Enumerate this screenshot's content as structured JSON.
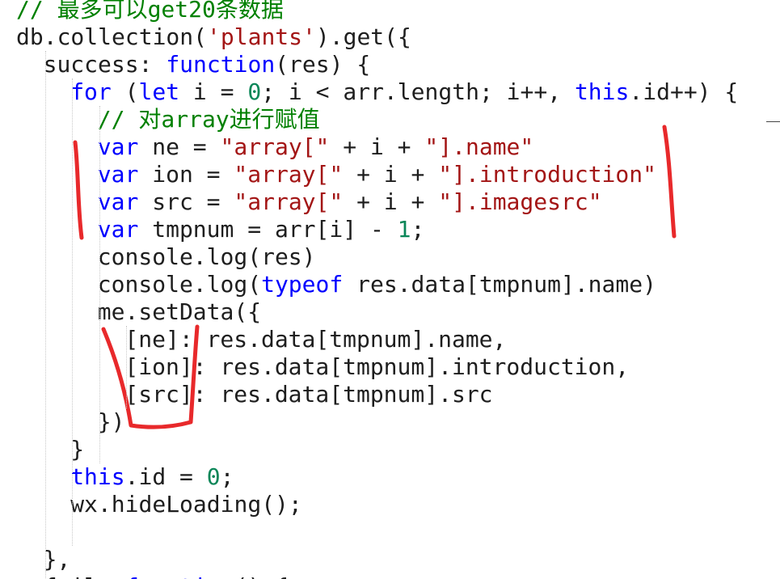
{
  "code_lines": [
    {
      "indent": 0,
      "tokens": [
        {
          "t": "// 最多可以get20条数据",
          "c": "cmt"
        }
      ]
    },
    {
      "indent": 0,
      "tokens": [
        {
          "t": "db.collection(",
          "c": ""
        },
        {
          "t": "'plants'",
          "c": "str"
        },
        {
          "t": ").get({",
          "c": ""
        }
      ]
    },
    {
      "indent": 2,
      "tokens": [
        {
          "t": "success: ",
          "c": ""
        },
        {
          "t": "function",
          "c": "kw"
        },
        {
          "t": "(res) {",
          "c": ""
        }
      ]
    },
    {
      "indent": 4,
      "tokens": [
        {
          "t": "for",
          "c": "kw"
        },
        {
          "t": " (",
          "c": ""
        },
        {
          "t": "let",
          "c": "kw"
        },
        {
          "t": " i = ",
          "c": ""
        },
        {
          "t": "0",
          "c": "num"
        },
        {
          "t": "; i < arr.length; i++, ",
          "c": ""
        },
        {
          "t": "this",
          "c": "kw"
        },
        {
          "t": ".id++) {",
          "c": ""
        }
      ]
    },
    {
      "indent": 6,
      "tokens": [
        {
          "t": "// 对array进行赋值",
          "c": "cmt"
        }
      ]
    },
    {
      "indent": 6,
      "tokens": [
        {
          "t": "var",
          "c": "kw"
        },
        {
          "t": " ne = ",
          "c": ""
        },
        {
          "t": "\"array[\"",
          "c": "str"
        },
        {
          "t": " + i + ",
          "c": ""
        },
        {
          "t": "\"].name\"",
          "c": "str"
        }
      ]
    },
    {
      "indent": 6,
      "tokens": [
        {
          "t": "var",
          "c": "kw"
        },
        {
          "t": " ion = ",
          "c": ""
        },
        {
          "t": "\"array[\"",
          "c": "str"
        },
        {
          "t": " + i + ",
          "c": ""
        },
        {
          "t": "\"].introduction\"",
          "c": "str"
        }
      ]
    },
    {
      "indent": 6,
      "tokens": [
        {
          "t": "var",
          "c": "kw"
        },
        {
          "t": " src = ",
          "c": ""
        },
        {
          "t": "\"array[\"",
          "c": "str"
        },
        {
          "t": " + i + ",
          "c": ""
        },
        {
          "t": "\"].imagesrc\"",
          "c": "str"
        }
      ]
    },
    {
      "indent": 6,
      "tokens": [
        {
          "t": "var",
          "c": "kw"
        },
        {
          "t": " tmpnum = arr[i] - ",
          "c": ""
        },
        {
          "t": "1",
          "c": "num"
        },
        {
          "t": ";",
          "c": ""
        }
      ]
    },
    {
      "indent": 6,
      "tokens": [
        {
          "t": "console.log(res)",
          "c": ""
        }
      ]
    },
    {
      "indent": 6,
      "tokens": [
        {
          "t": "console.log(",
          "c": ""
        },
        {
          "t": "typeof",
          "c": "kw"
        },
        {
          "t": " res.data[tmpnum].name)",
          "c": ""
        }
      ]
    },
    {
      "indent": 6,
      "tokens": [
        {
          "t": "me.setData({",
          "c": ""
        }
      ]
    },
    {
      "indent": 8,
      "tokens": [
        {
          "t": "[ne]: res.data[tmpnum].name,",
          "c": ""
        }
      ]
    },
    {
      "indent": 8,
      "tokens": [
        {
          "t": "[ion]: res.data[tmpnum].introduction,",
          "c": ""
        }
      ]
    },
    {
      "indent": 8,
      "tokens": [
        {
          "t": "[src]: res.data[tmpnum].src",
          "c": ""
        }
      ]
    },
    {
      "indent": 6,
      "tokens": [
        {
          "t": "})",
          "c": ""
        }
      ]
    },
    {
      "indent": 4,
      "tokens": [
        {
          "t": "}",
          "c": ""
        }
      ]
    },
    {
      "indent": 4,
      "tokens": [
        {
          "t": "this",
          "c": "kw"
        },
        {
          "t": ".id = ",
          "c": ""
        },
        {
          "t": "0",
          "c": "num"
        },
        {
          "t": ";",
          "c": ""
        }
      ]
    },
    {
      "indent": 4,
      "tokens": [
        {
          "t": "wx.hideLoading();",
          "c": ""
        }
      ]
    },
    {
      "indent": 0,
      "tokens": [
        {
          "t": "",
          "c": ""
        }
      ]
    },
    {
      "indent": 2,
      "tokens": [
        {
          "t": "},",
          "c": ""
        }
      ]
    },
    {
      "indent": 2,
      "tokens": [
        {
          "t": "fail: ",
          "c": ""
        },
        {
          "t": "function",
          "c": "kw"
        },
        {
          "t": "() {",
          "c": ""
        }
      ]
    }
  ],
  "colors": {
    "text": "#1e1e1e",
    "comment": "#008000",
    "keyword": "#0000ff",
    "string": "#a31515",
    "number": "#098658",
    "annotation": "#e8292b"
  },
  "annotation_marks": [
    "red-bracket-left",
    "red-bracket-right",
    "red-hook-under-setdata-keys"
  ]
}
